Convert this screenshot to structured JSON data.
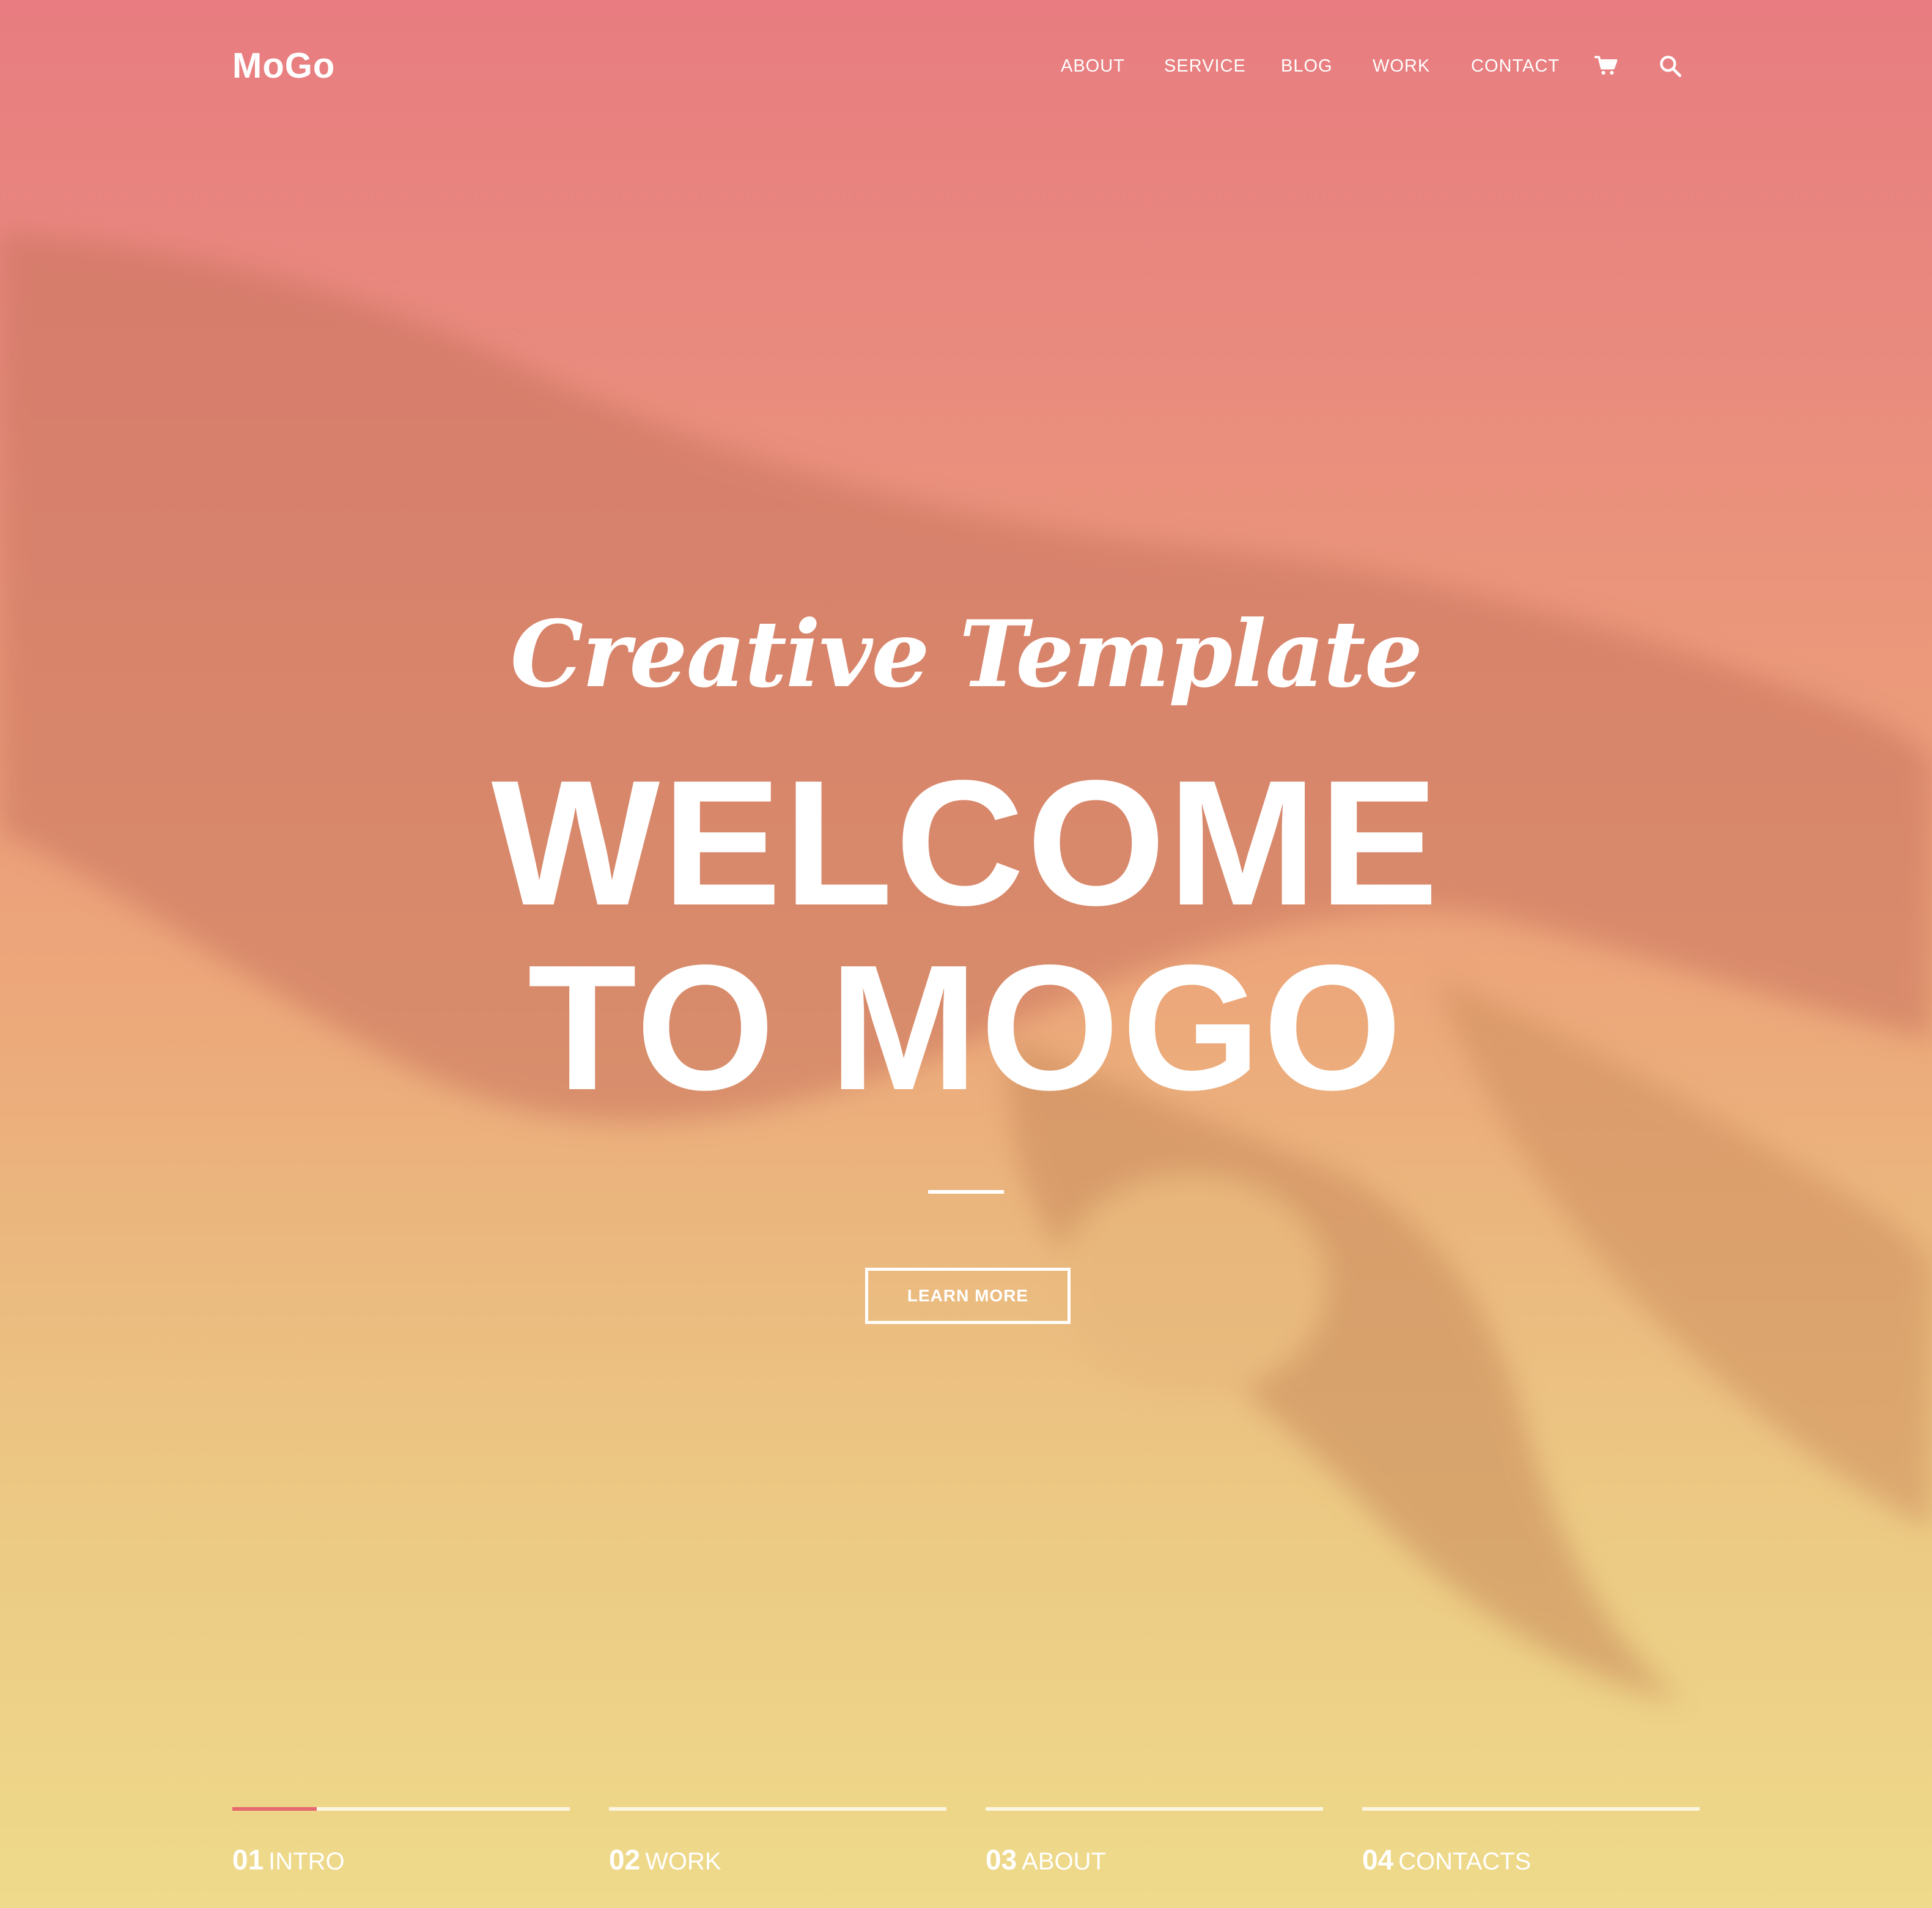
{
  "brand": {
    "logo": "MoGo"
  },
  "nav": {
    "items": [
      {
        "label": "ABOUT"
      },
      {
        "label": "SERVICE"
      },
      {
        "label": "BLOG"
      },
      {
        "label": "WORK"
      },
      {
        "label": "CONTACT"
      }
    ],
    "cart_icon": "cart-icon",
    "search_icon": "search-icon"
  },
  "hero": {
    "tagline": "Creative Template",
    "headline_line1": "WELCOME",
    "headline_line2": "TO MOGO",
    "button_label": "LEARN MORE"
  },
  "slides": [
    {
      "number": "01",
      "label": "INTRO",
      "progress": 0.25
    },
    {
      "number": "02",
      "label": "WORK",
      "progress": 0
    },
    {
      "number": "03",
      "label": "ABOUT",
      "progress": 0
    },
    {
      "number": "04",
      "label": "CONTACTS",
      "progress": 0
    }
  ],
  "colors": {
    "accent": "#e5696f",
    "gradient_top": "#e87c80",
    "gradient_bottom": "#eeda8a",
    "text": "#ffffff"
  }
}
